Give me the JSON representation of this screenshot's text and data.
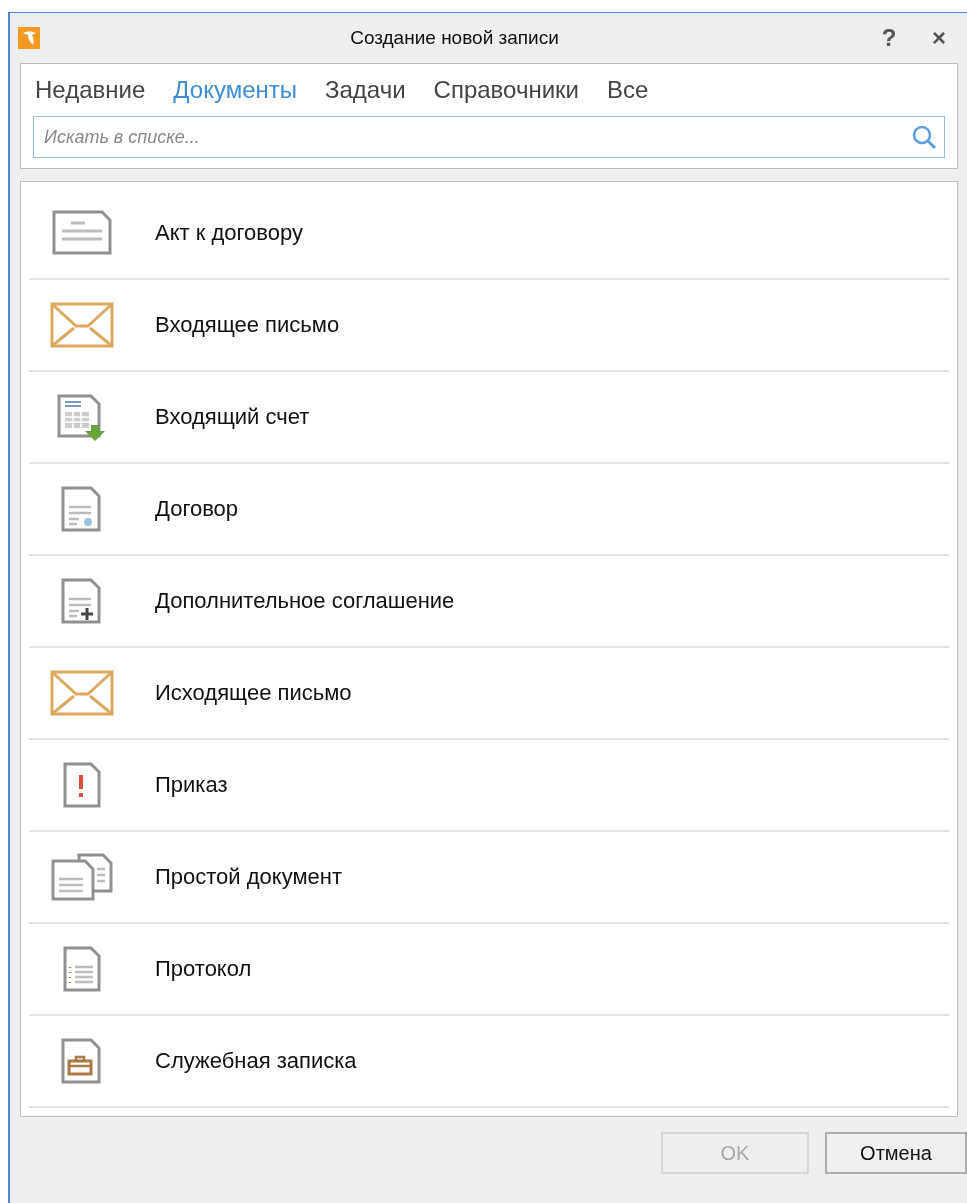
{
  "window": {
    "title": "Создание новой записи",
    "help": "?",
    "close": "×"
  },
  "tabs": [
    {
      "label": "Недавние",
      "selected": false
    },
    {
      "label": "Документы",
      "selected": true
    },
    {
      "label": "Задачи",
      "selected": false
    },
    {
      "label": "Справочники",
      "selected": false
    },
    {
      "label": "Все",
      "selected": false
    }
  ],
  "search": {
    "placeholder": "Искать в списке..."
  },
  "items": [
    {
      "label": "Акт к договору",
      "kind": "act"
    },
    {
      "label": "Входящее письмо",
      "kind": "letter"
    },
    {
      "label": "Входящий счет",
      "kind": "invoice"
    },
    {
      "label": "Договор",
      "kind": "contract"
    },
    {
      "label": "Дополнительное соглашение",
      "kind": "addendum"
    },
    {
      "label": "Исходящее письмо",
      "kind": "letter"
    },
    {
      "label": "Приказ",
      "kind": "order"
    },
    {
      "label": "Простой документ",
      "kind": "simple"
    },
    {
      "label": "Протокол",
      "kind": "protocol"
    },
    {
      "label": "Служебная записка",
      "kind": "memo"
    }
  ],
  "buttons": [
    {
      "label": "OK",
      "disabled": true
    },
    {
      "label": "Отмена",
      "disabled": false
    }
  ]
}
